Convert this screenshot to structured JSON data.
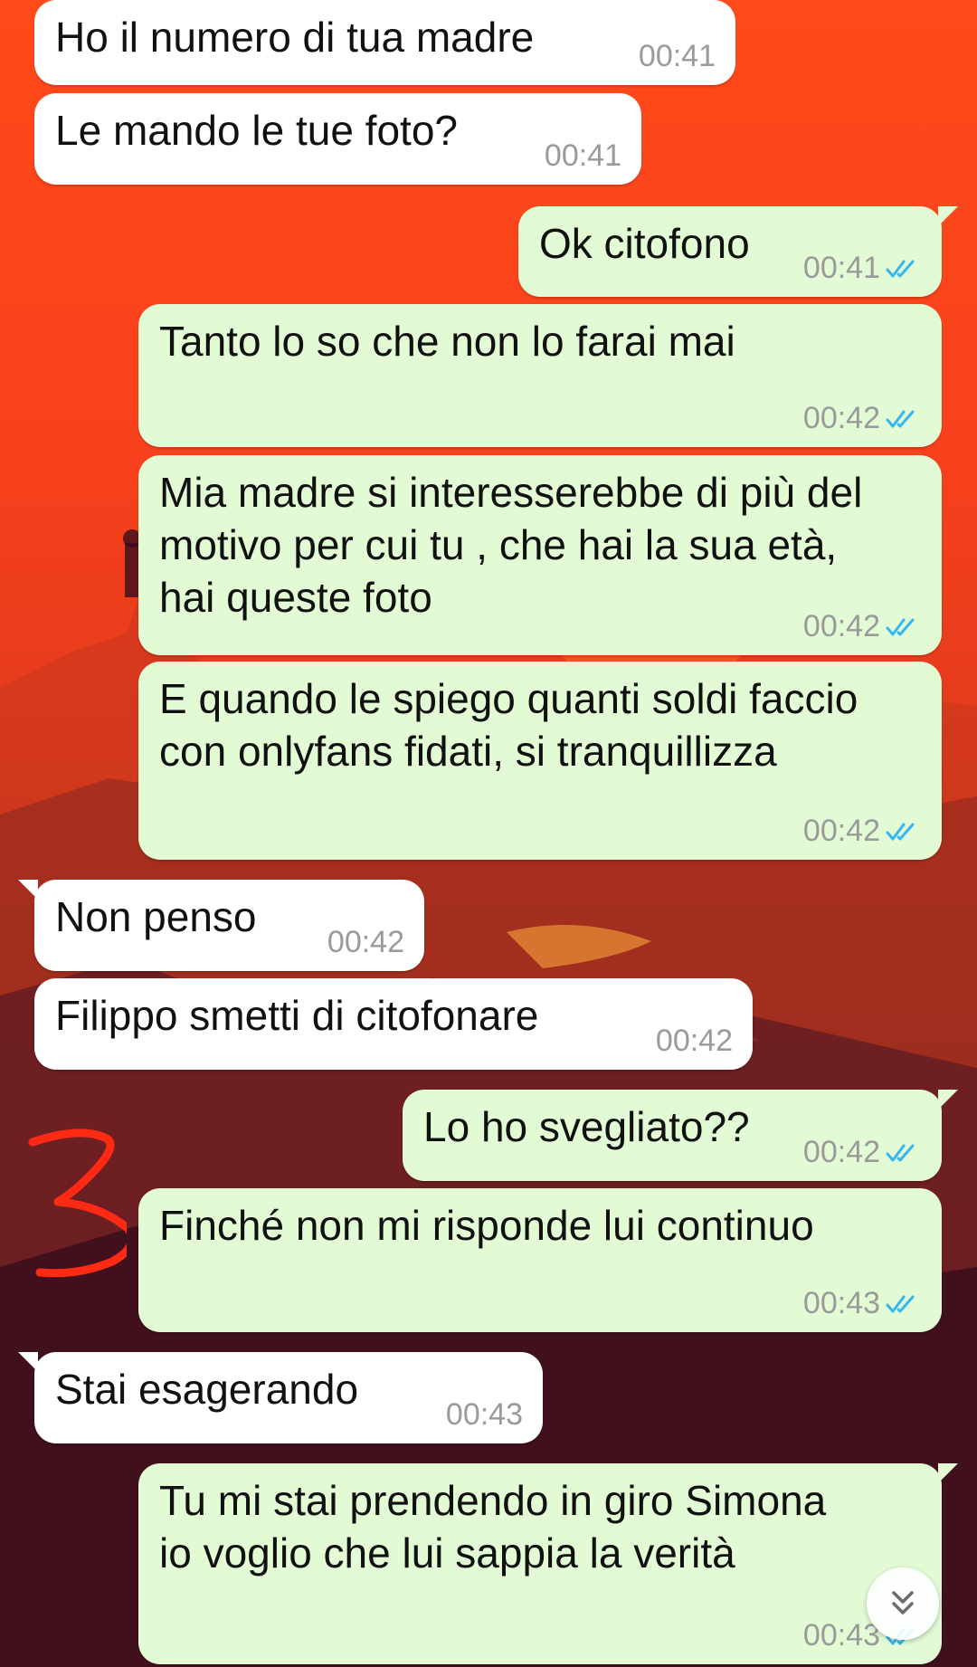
{
  "colors": {
    "incoming_bubble": "#ffffff",
    "outgoing_bubble": "#e2fbd5",
    "timestamp": "#9a9a9a",
    "read_ticks": "#34b7f1",
    "annotation": "#ff2a14"
  },
  "messages": [
    {
      "direction": "in",
      "text": "Ho il numero di tua madre",
      "time": "00:41"
    },
    {
      "direction": "in",
      "text": "Le mando le tue foto?",
      "time": "00:41"
    },
    {
      "direction": "out",
      "text": "Ok citofono",
      "time": "00:41",
      "status": "read-double-check-icon"
    },
    {
      "direction": "out",
      "text": "Tanto lo so che non lo farai mai",
      "time": "00:42",
      "status": "read-double-check-icon"
    },
    {
      "direction": "out",
      "text": "Mia madre si interesserebbe di più del\nmotivo per cui tu , che hai la sua età,\nhai queste foto",
      "time": "00:42",
      "status": "read-double-check-icon"
    },
    {
      "direction": "out",
      "text": "E quando le spiego quanti soldi faccio\ncon onlyfans fidati, si tranquillizza",
      "time": "00:42",
      "status": "read-double-check-icon"
    },
    {
      "direction": "in",
      "text": "Non penso",
      "time": "00:42"
    },
    {
      "direction": "in",
      "text": "Filippo smetti di citofonare",
      "time": "00:42"
    },
    {
      "direction": "out",
      "text": "Lo ho svegliato??",
      "time": "00:42",
      "status": "read-double-check-icon"
    },
    {
      "direction": "out",
      "text": "Finché non mi risponde lui continuo",
      "time": "00:43",
      "status": "read-double-check-icon"
    },
    {
      "direction": "in",
      "text": "Stai esagerando",
      "time": "00:43"
    },
    {
      "direction": "out",
      "text": "Tu mi stai prendendo in giro Simona\nio voglio che lui sappia la verità",
      "time": "00:43",
      "status": "read-double-check-icon"
    }
  ],
  "annotation": {
    "text": "3"
  },
  "scroll_button": {
    "icon": "double-chevron-down-icon"
  }
}
